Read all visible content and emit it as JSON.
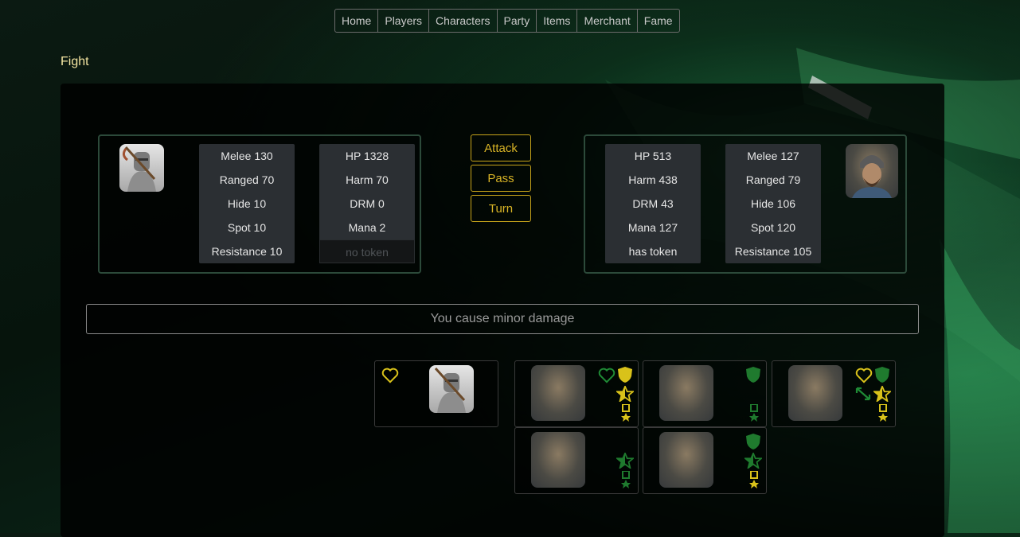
{
  "nav": {
    "items": [
      "Home",
      "Players",
      "Characters",
      "Party",
      "Items",
      "Merchant",
      "Fame"
    ]
  },
  "page": {
    "title": "Fight"
  },
  "player": {
    "portrait": "knight-portrait",
    "combat": [
      "Melee 130",
      "Ranged 70",
      "Hide 10",
      "Spot 10",
      "Resistance 10"
    ],
    "vitals": [
      "HP 1328",
      "Harm 70",
      "DRM 0",
      "Mana 2"
    ],
    "token": "no token"
  },
  "actions": {
    "attack": "Attack",
    "pass": "Pass",
    "turn": "Turn"
  },
  "enemy": {
    "portrait": "warrior-portrait",
    "vitals": [
      "HP 513",
      "Harm 438",
      "DRM 43",
      "Mana 127",
      "has token"
    ],
    "combat": [
      "Melee 127",
      "Ranged 79",
      "Hide 106",
      "Spot 120",
      "Resistance 105"
    ]
  },
  "message": "You cause minor damage",
  "colors": {
    "gold": "#d9b426",
    "green": "#1f7a2e",
    "button_border": "#c9a51b",
    "title": "#f2e3a0",
    "panel_border": "#2c4a3a"
  },
  "party_card": {
    "icons": [
      "heart-outline-gold-icon",
      "knight-portrait"
    ]
  },
  "enemy_cards": [
    {
      "icons": [
        "heart-outline-green-icon",
        "shield-gold-icon",
        "star-half-gold-icon",
        "medal-gold-icon"
      ]
    },
    {
      "icons": [
        "shield-green-icon",
        "medal-green-icon"
      ]
    },
    {
      "icons": [
        "heart-outline-gold-icon",
        "shield-green-icon",
        "arrows-green-icon",
        "star-half-gold-icon",
        "medal-gold-icon"
      ]
    },
    {
      "icons": [
        "star-green-icon",
        "medal-green-icon"
      ]
    },
    {
      "icons": [
        "shield-green-icon",
        "star-green-icon",
        "medal-gold-icon"
      ]
    }
  ]
}
